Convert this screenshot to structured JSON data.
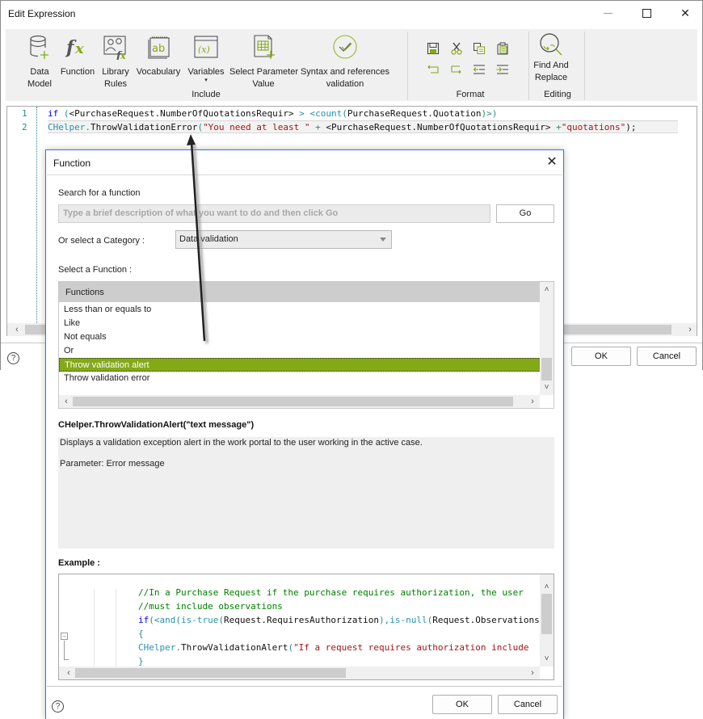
{
  "main_window": {
    "title": "Edit Expression",
    "window_controls": [
      "minimize",
      "maximize",
      "close"
    ],
    "ribbon": {
      "include_group": {
        "label": "Include",
        "buttons": [
          {
            "id": "data-model",
            "label_line1": "Data",
            "label_line2": "Model",
            "icon": "database-plus-icon"
          },
          {
            "id": "function",
            "label_line1": "Function",
            "label_line2": "",
            "icon": "fx-icon"
          },
          {
            "id": "library-rules",
            "label_line1": "Library",
            "label_line2": "Rules",
            "icon": "library-rules-icon"
          },
          {
            "id": "vocabulary",
            "label_line1": "Vocabulary",
            "label_line2": "",
            "icon": "vocabulary-notebook-icon"
          },
          {
            "id": "variables",
            "label_line1": "Variables",
            "label_line2": "▾",
            "icon": "variables-icon"
          },
          {
            "id": "select-parameter-value",
            "label_line1": "Select Parameter",
            "label_line2": "Value",
            "icon": "table-plus-icon"
          },
          {
            "id": "syntax-validation",
            "label_line1": "Syntax and references",
            "label_line2": "validation",
            "icon": "check-circle-icon"
          }
        ]
      },
      "format_group": {
        "label": "Format",
        "icons": [
          "save-icon",
          "cut-icon",
          "copy-icon",
          "paste-icon",
          "undo-icon",
          "redo-icon",
          "outdent-icon",
          "indent-icon"
        ]
      },
      "editing_group": {
        "label": "Editing",
        "button": {
          "label_line1": "Find And",
          "label_line2": "Replace",
          "icon": "find-replace-icon"
        }
      }
    },
    "editor": {
      "lines": [
        {
          "number": "1",
          "tokens": [
            {
              "t": "if",
              "c": "kw"
            },
            {
              "t": " (",
              "c": "gr"
            },
            {
              "t": "<PurchaseRequest.NumberOfQuotationsRequir>",
              "c": "tx"
            },
            {
              "t": " > ",
              "c": "gr"
            },
            {
              "t": "<",
              "c": "gr"
            },
            {
              "t": "count",
              "c": "fn"
            },
            {
              "t": "(",
              "c": "gr"
            },
            {
              "t": "PurchaseRequest.Quotation",
              "c": "tx"
            },
            {
              "t": ")>)",
              "c": "gr"
            }
          ]
        },
        {
          "number": "2",
          "tokens": [
            {
              "t": "CHelper",
              "c": "fn"
            },
            {
              "t": ".",
              "c": "gr"
            },
            {
              "t": "ThrowValidationError",
              "c": "tx"
            },
            {
              "t": "(",
              "c": "gr"
            },
            {
              "t": "\"You need at least \"",
              "c": "st"
            },
            {
              "t": " + ",
              "c": "gr"
            },
            {
              "t": "<PurchaseRequest.NumberOfQuotationsRequir>",
              "c": "tx"
            },
            {
              "t": " +",
              "c": "gr"
            },
            {
              "t": "\"quotations\"",
              "c": "st"
            },
            {
              "t": ");",
              "c": "tx"
            }
          ]
        }
      ]
    },
    "buttons": {
      "ok": "OK",
      "cancel": "Cancel"
    },
    "help": "?"
  },
  "function_dialog": {
    "title": "Function",
    "search_label": "Search for a function",
    "search_placeholder": "Type a brief description of what you want to do and then click Go",
    "go_label": "Go",
    "category_label": "Or select a Category :",
    "category_value": "Data validation",
    "select_function_label": "Select a Function :",
    "functions_header": "Functions",
    "functions": [
      {
        "label": "Less than or equals to",
        "selected": false
      },
      {
        "label": "Like",
        "selected": false
      },
      {
        "label": "Not equals",
        "selected": false
      },
      {
        "label": "Or",
        "selected": false
      },
      {
        "label": "Throw validation alert",
        "selected": true
      },
      {
        "label": "Throw validation error",
        "selected": false
      }
    ],
    "signature": "CHelper.ThrowValidationAlert(\"text message\")",
    "description": "Displays a validation exception alert in the work portal to the user working in the active case.",
    "parameter": "Parameter: Error message",
    "example_label": "Example :",
    "example_lines": [
      [
        {
          "t": "//In a Purchase Request if the purchase requires authorization, the user",
          "c": "cm"
        }
      ],
      [
        {
          "t": "//must include observations",
          "c": "cm"
        }
      ],
      [
        {
          "t": "if",
          "c": "kw"
        },
        {
          "t": "(<",
          "c": "gr"
        },
        {
          "t": "and",
          "c": "fn"
        },
        {
          "t": "(",
          "c": "gr"
        },
        {
          "t": "is-true",
          "c": "fn"
        },
        {
          "t": "(",
          "c": "gr"
        },
        {
          "t": "Request.RequiresAuthorization",
          "c": "tx"
        },
        {
          "t": "),",
          "c": "gr"
        },
        {
          "t": "is-null",
          "c": "fn"
        },
        {
          "t": "(",
          "c": "gr"
        },
        {
          "t": "Request.Observations",
          "c": "tx"
        }
      ],
      [
        {
          "t": "{",
          "c": "gr"
        }
      ],
      [
        {
          "t": "CHelper",
          "c": "fn"
        },
        {
          "t": ".",
          "c": "gr"
        },
        {
          "t": "ThrowValidationAlert",
          "c": "tx"
        },
        {
          "t": "(",
          "c": "gr"
        },
        {
          "t": "\"If a request requires authorization include",
          "c": "st"
        }
      ],
      [
        {
          "t": "}",
          "c": "gr"
        }
      ]
    ],
    "buttons": {
      "ok": "OK",
      "cancel": "Cancel"
    },
    "help": "?"
  },
  "colors": {
    "accent_green": "#84a917",
    "dialog_border": "#2b7cd3"
  }
}
